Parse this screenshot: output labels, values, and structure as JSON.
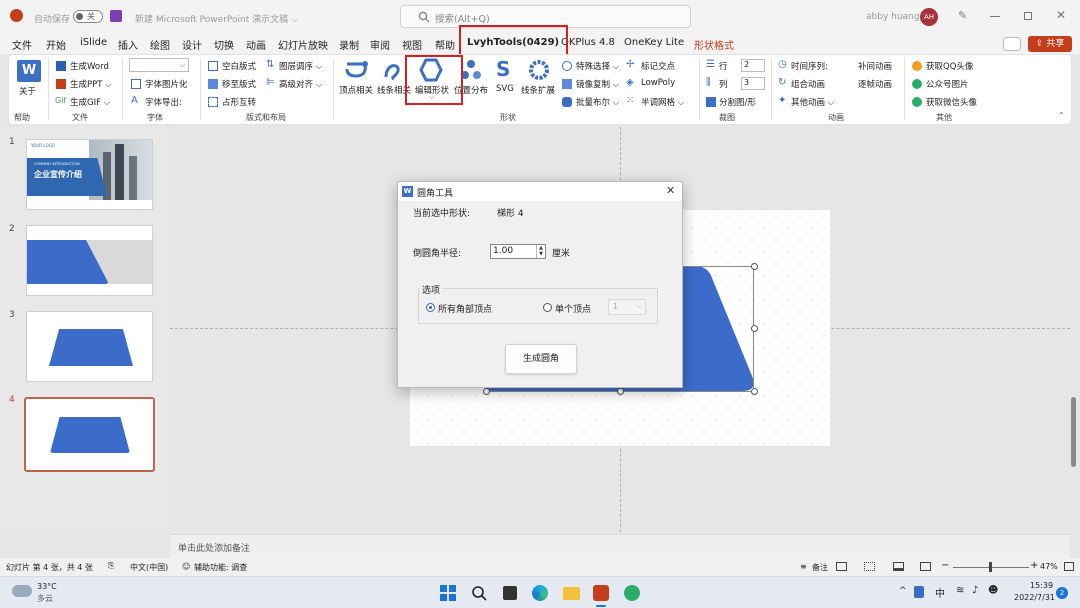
{
  "titlebar": {
    "autosave": "自动保存",
    "toggle": "关",
    "doc_title": "新建 Microsoft PowerPoint 演示文稿 ⌵",
    "search_placeholder": "搜索(Alt+Q)",
    "user": "abby huang",
    "avatar": "AH"
  },
  "menu": [
    "文件",
    "开始",
    "iSlide",
    "插入",
    "绘图",
    "设计",
    "切换",
    "动画",
    "幻灯片放映",
    "录制",
    "审阅",
    "视图",
    "帮助",
    "LvyhTools(0429)",
    "OKPlus 4.8",
    "OneKey Lite",
    "形状格式"
  ],
  "share": "共享",
  "ribbon": {
    "about": "关于",
    "help": "帮助",
    "file": {
      "items": [
        "生成Word",
        "生成PPT ⌵",
        "生成GIF ⌵"
      ],
      "label": "文件"
    },
    "font": {
      "items": [
        "字体图片化",
        "字体导出:"
      ],
      "label": "字体"
    },
    "layout": {
      "items": [
        "空白版式",
        "移至版式",
        "占形互转",
        "图层调序 ⌵",
        "高级对齐 ⌵"
      ],
      "label": "版式和布局"
    },
    "shape": {
      "buttons": [
        "顶点相关",
        "线条相关",
        "编辑形状",
        "位置分布",
        "SVG",
        "线条扩展"
      ],
      "items": [
        "特殊选择 ⌵",
        "镜像复制 ⌵",
        "批量布尔 ⌵",
        "标记交点",
        "LowPoly",
        "半调网格 ⌵"
      ],
      "label": "形状"
    },
    "crop": {
      "rows": "行",
      "cols": "列",
      "rows_val": "2",
      "cols_val": "3",
      "split": "分割图/形",
      "label": "裁图"
    },
    "anim": {
      "items": [
        "时间序列:",
        "组合动画",
        "其他动画 ⌵",
        "补间动画",
        "逐帧动画"
      ],
      "label": "动画"
    },
    "other": {
      "items": [
        "获取QQ头像",
        "公众号图片",
        "获取微信头像"
      ],
      "label": "其他"
    }
  },
  "slides": [
    {
      "num": "1",
      "logo": "YOUR LOGO",
      "sub": "COMPANY INTRODUCTION",
      "title": "企业宣传介绍"
    },
    {
      "num": "2"
    },
    {
      "num": "3"
    },
    {
      "num": "4"
    }
  ],
  "dialog": {
    "title": "圆角工具",
    "current_label": "当前选中形状:",
    "current_value": "梯形 4",
    "radius_label": "倒圆角半径:",
    "radius_value": "1.00",
    "unit": "厘米",
    "options_label": "选项",
    "opt_all": "所有角部顶点",
    "opt_single": "单个顶点",
    "single_select": "1",
    "generate": "生成圆角"
  },
  "notes": "单击此处添加备注",
  "status": {
    "slide": "幻灯片 第 4 张，共 4 张",
    "lang": "中文(中国)",
    "access": "辅助功能: 调查",
    "notes": "备注",
    "zoom": "47%"
  },
  "taskbar": {
    "temp": "33°C",
    "weather": "多云",
    "time": "15:39",
    "date": "2022/7/31",
    "badge": "2"
  },
  "colors": {
    "accent": "#3a6fc4",
    "shape": "#3b6cc9",
    "red": "#d32020",
    "ppt": "#c43e1c"
  }
}
